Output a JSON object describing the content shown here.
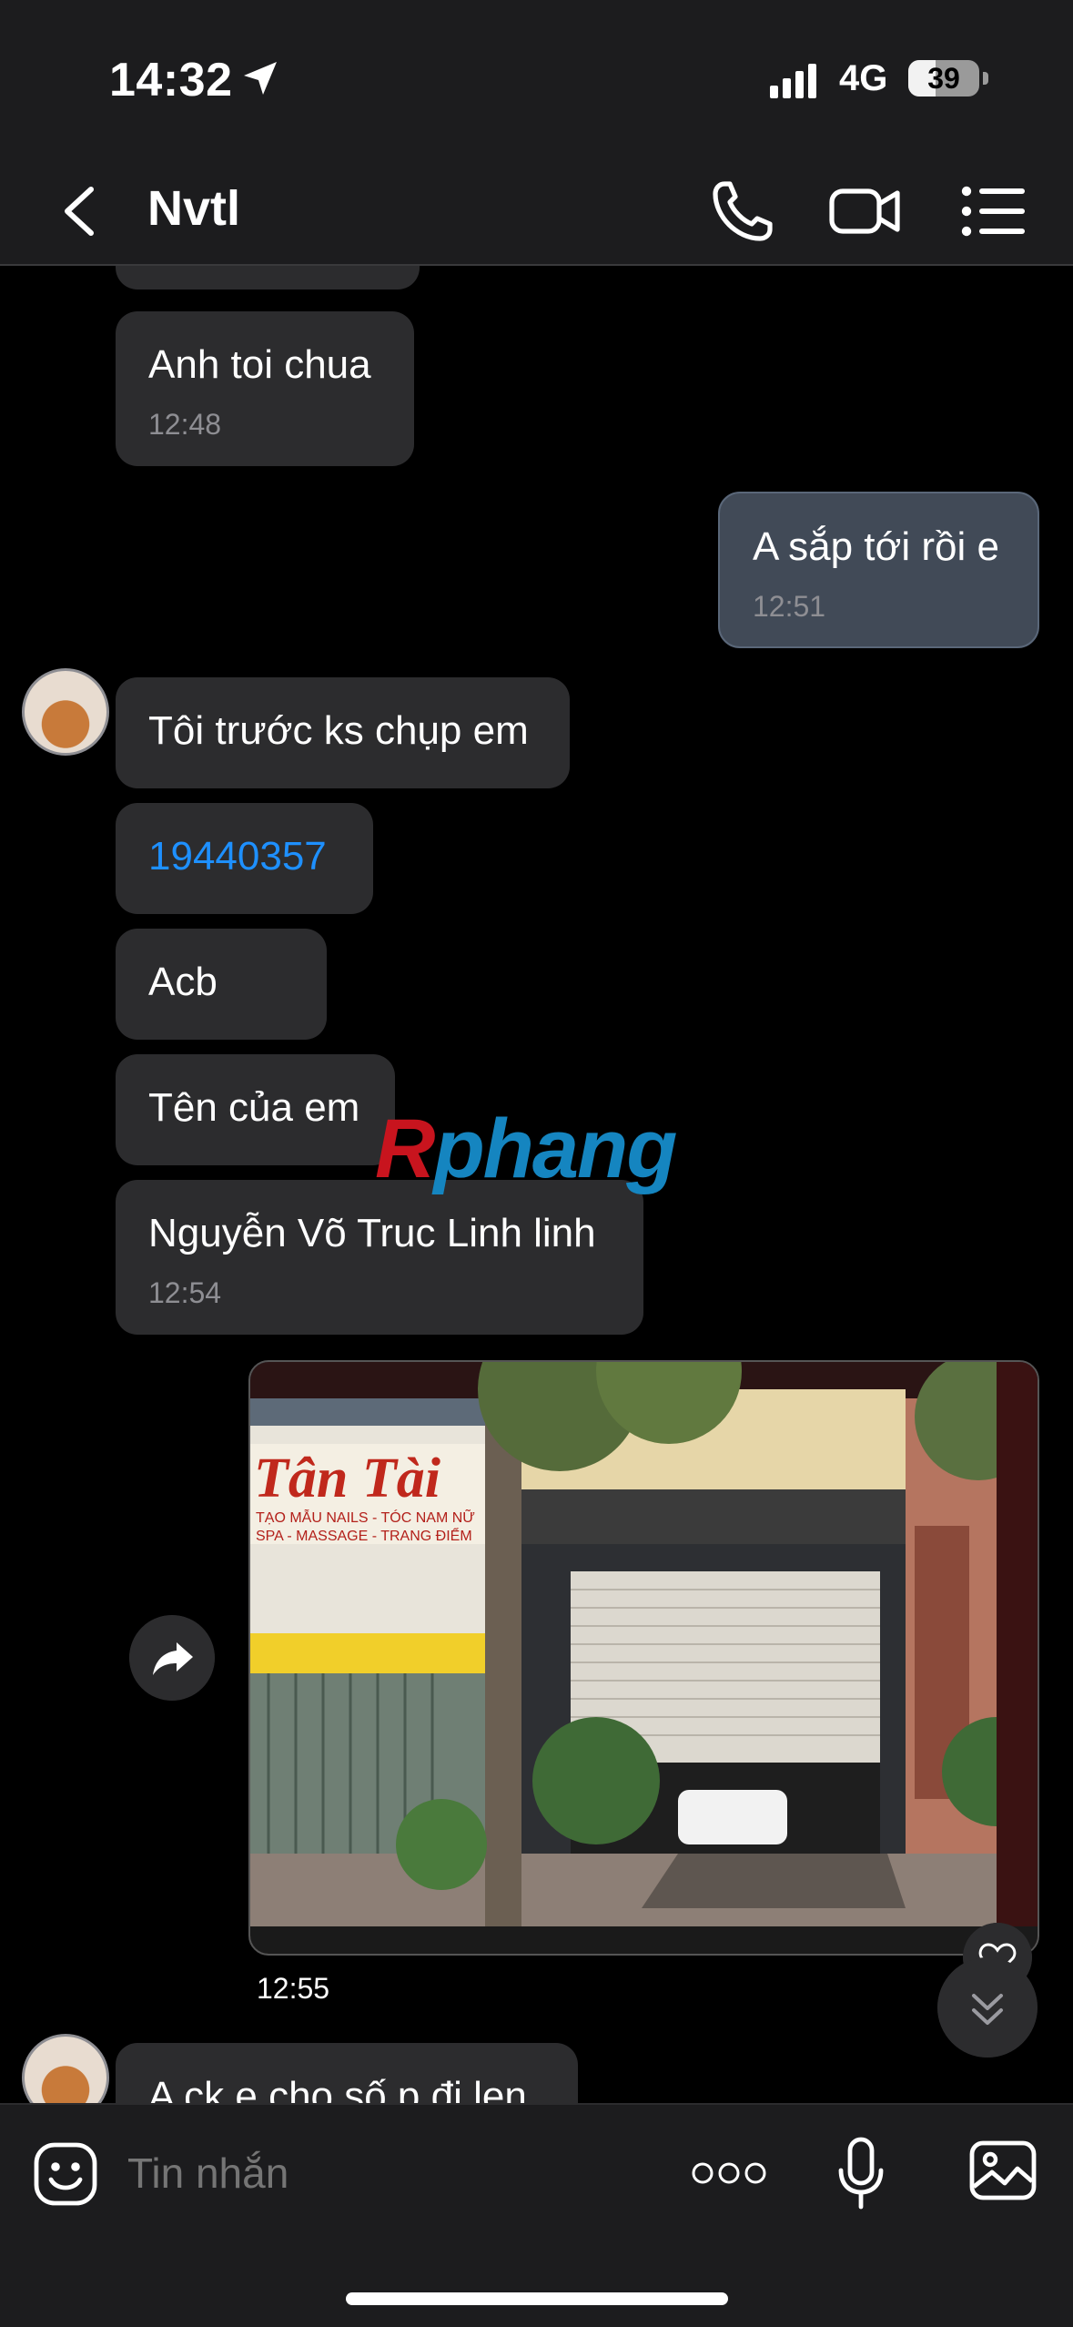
{
  "status_bar": {
    "time": "14:32",
    "network": "4G",
    "battery": "39",
    "battery_level_percent": 39
  },
  "header": {
    "back_icon": "chevron-left-icon",
    "title": "Nvtl",
    "actions": [
      "phone-icon",
      "video-call-icon",
      "list-menu-icon"
    ]
  },
  "messages": [
    {
      "id": "m1",
      "side": "received",
      "text": "Anh toi chua",
      "time": "12:48"
    },
    {
      "id": "m2",
      "side": "sent",
      "text": "A sắp tới rồi e",
      "time": "12:51"
    },
    {
      "id": "m3",
      "side": "received",
      "text": "Tôi trước ks chụp em"
    },
    {
      "id": "m4",
      "side": "received",
      "text": "19440357",
      "link": true
    },
    {
      "id": "m5",
      "side": "received",
      "text": "Acb"
    },
    {
      "id": "m6",
      "side": "received",
      "text": "Tên của em"
    },
    {
      "id": "m7",
      "side": "received",
      "text": "Nguyễn Võ Truc Linh linh",
      "time": "12:54"
    },
    {
      "id": "m8",
      "side": "sent",
      "type": "image",
      "time": "12:55"
    },
    {
      "id": "m9",
      "side": "received",
      "text": "A ck e cho số p đi len"
    }
  ],
  "photo_sign": {
    "brand": "Tân Tài",
    "lines": [
      "TẠO MẪU NAILS - TÓC NAM NỮ",
      "SPA - MASSAGE - TRANG ĐIỂM"
    ]
  },
  "watermark": {
    "part1": "R",
    "part2": "phang"
  },
  "input_bar": {
    "placeholder": "Tin nhắn",
    "icons": [
      "emoji-icon",
      "more-icon",
      "microphone-icon",
      "gallery-icon"
    ]
  },
  "colors": {
    "background": "#000000",
    "bar": "#1c1c1e",
    "bubble_received": "#2c2c2e",
    "bubble_sent": "#414a57",
    "link": "#1e90ff",
    "timestamp": "#8e8e93"
  }
}
